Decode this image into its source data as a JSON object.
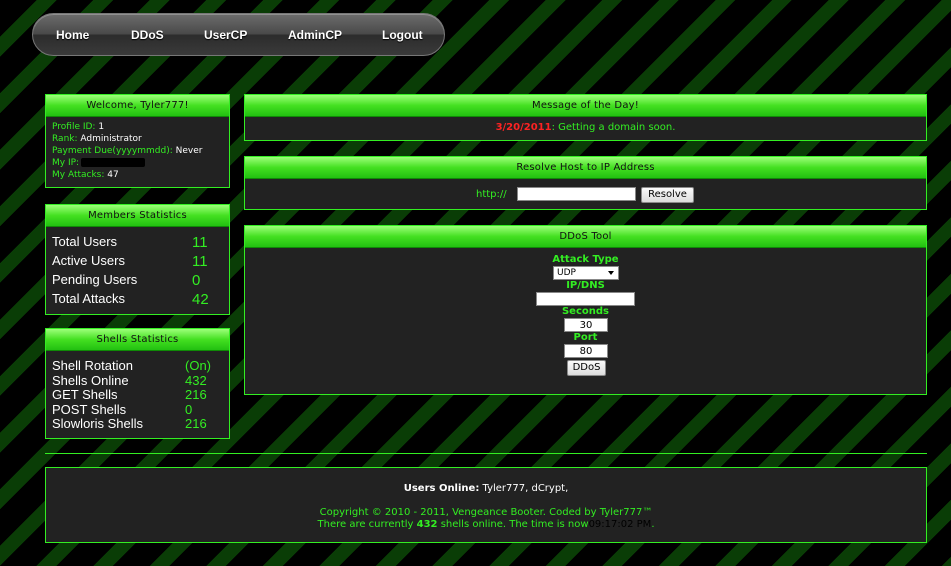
{
  "nav": {
    "items": [
      "Home",
      "DDoS",
      "UserCP",
      "AdminCP",
      "Logout"
    ]
  },
  "welcome": {
    "title": "Welcome, Tyler777!",
    "profile_id_label": "Profile ID:",
    "profile_id": "1",
    "rank_label": "Rank:",
    "rank": "Administrator",
    "payment_label": "Payment Due(yyyymmdd):",
    "payment": "Never",
    "ip_label": "My IP:",
    "attacks_label": "My Attacks:",
    "attacks": "47"
  },
  "members": {
    "title": "Members Statistics",
    "rows": [
      {
        "label": "Total Users",
        "value": "11"
      },
      {
        "label": "Active Users",
        "value": "11"
      },
      {
        "label": "Pending Users",
        "value": "0"
      },
      {
        "label": "Total Attacks",
        "value": "42"
      }
    ]
  },
  "shells": {
    "title": "Shells Statistics",
    "rows": [
      {
        "label": "Shell Rotation",
        "value": "(On)"
      },
      {
        "label": "Shells Online",
        "value": "432"
      },
      {
        "label": "GET Shells",
        "value": "216"
      },
      {
        "label": "POST Shells",
        "value": "0"
      },
      {
        "label": "Slowloris Shells",
        "value": "216"
      }
    ]
  },
  "motd": {
    "title": "Message of the Day!",
    "date": "3/20/2011",
    "message": ": Getting a domain soon."
  },
  "resolve": {
    "title": "Resolve Host to IP Address",
    "prefix": "http://",
    "host_value": "",
    "button": "Resolve"
  },
  "ddos": {
    "title": "DDoS Tool",
    "attack_type_label": "Attack Type",
    "attack_type_value": "UDP",
    "ip_label": "IP/DNS",
    "ip_value": "",
    "seconds_label": "Seconds",
    "seconds_value": "30",
    "port_label": "Port",
    "port_value": "80",
    "button": "DDoS"
  },
  "footer": {
    "users_online_label": "Users Online:",
    "users_online": "Tyler777, dCrypt,",
    "copyright": "Copyright © 2010 - 2011, Vengeance Booter. Coded by Tyler777™",
    "shells_prefix": "There are currently",
    "shells_count": "432",
    "shells_suffix": "shells online. The time is now",
    "time": "09:17:02 PM",
    "end": "."
  },
  "colors": {
    "accent": "#33ee22",
    "date_red": "#ff2222",
    "panel_bg": "#222222"
  }
}
